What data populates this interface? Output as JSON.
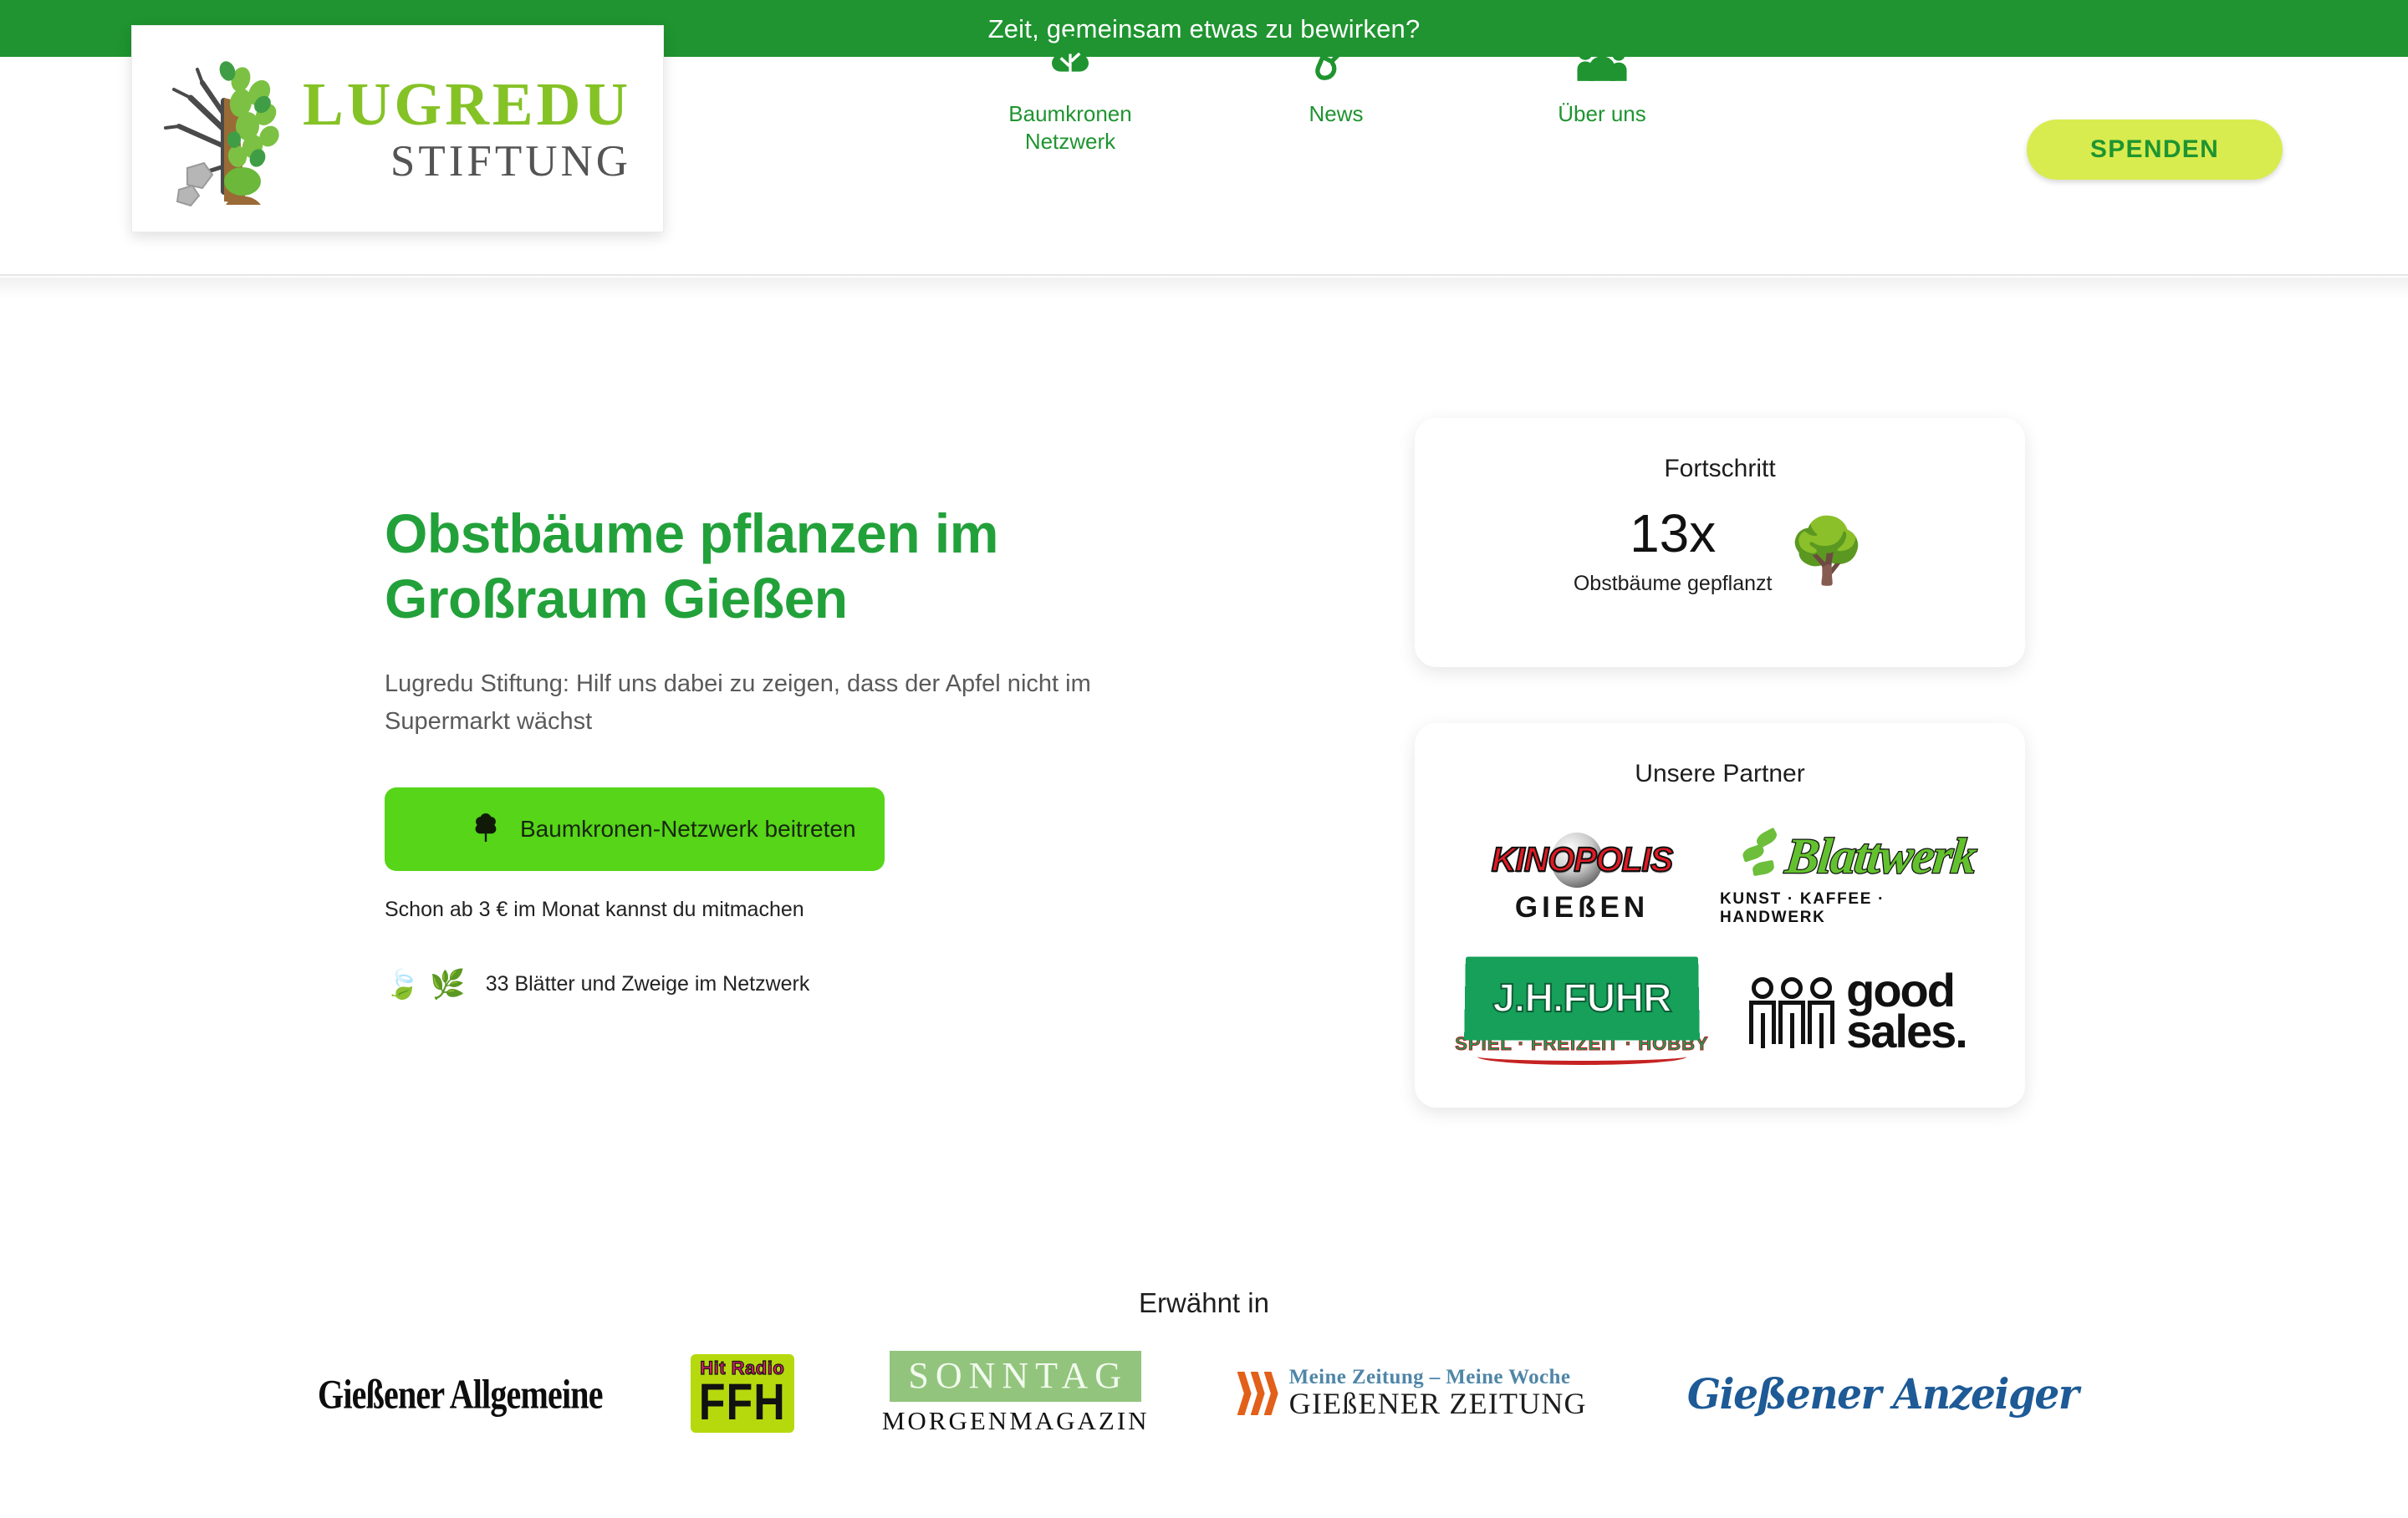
{
  "announcement": {
    "text": "Zeit, gemeinsam etwas zu bewirken?",
    "background_color": "#1f9430",
    "text_color": "#ffffff"
  },
  "header": {
    "logo": {
      "name_main": "LUGREDU",
      "name_sub": "STIFTUNG",
      "main_color": "#85c226",
      "sub_color": "#545454"
    },
    "nav": [
      {
        "label": "Baumkronen Netzwerk",
        "icon": "tree-icon"
      },
      {
        "label": "News",
        "icon": "shovel-icon"
      },
      {
        "label": "Über uns",
        "icon": "people-group-icon"
      }
    ],
    "donate_button": {
      "label": "SPENDEN",
      "background_color": "#d8ec4f",
      "text_color": "#1f9430"
    }
  },
  "hero": {
    "title": "Obstbäume pflanzen im Großraum Gießen",
    "title_color": "#22a13a",
    "subtitle": "Lugredu Stiftung: Hilf uns dabei zu zeigen, dass der Apfel nicht im Supermarkt wächst",
    "cta": {
      "label": "Baumkronen-Netzwerk beitreten",
      "icon": "tree-icon",
      "background_color": "#56d519"
    },
    "price_note": "Schon ab 3 € im Monat kannst du mitmachen",
    "network_stat": {
      "text": "33 Blätter und Zweige im Netzwerk",
      "emoji_leaf": "🍃",
      "emoji_branch": "🌿"
    }
  },
  "progress_card": {
    "heading": "Fortschritt",
    "count": "13x",
    "caption": "Obstbäume gepflanzt",
    "emoji": "🌳"
  },
  "partner_card": {
    "heading": "Unsere Partner",
    "partners": [
      {
        "name": "KINOPOLIS",
        "city": "GIEßEN"
      },
      {
        "name": "Blattwerk",
        "tagline": "KUNST · KAFFEE · HANDWERK"
      },
      {
        "name": "J.H.FUHR",
        "tagline": "SPIEL · FREIZEIT · HOBBY"
      },
      {
        "name_line1": "good",
        "name_line2": "sales."
      }
    ]
  },
  "press": {
    "heading": "Erwähnt in",
    "outlets": [
      {
        "name": "Gießener Allgemeine"
      },
      {
        "top": "Hit Radio",
        "main": "FFH"
      },
      {
        "top": "SONNTAG",
        "bottom": "MORGENMAGAZIN"
      },
      {
        "top": "Meine Zeitung – Meine Woche",
        "bottom": "GIEßENER ZEITUNG"
      },
      {
        "name": "Gießener Anzeiger"
      }
    ]
  }
}
